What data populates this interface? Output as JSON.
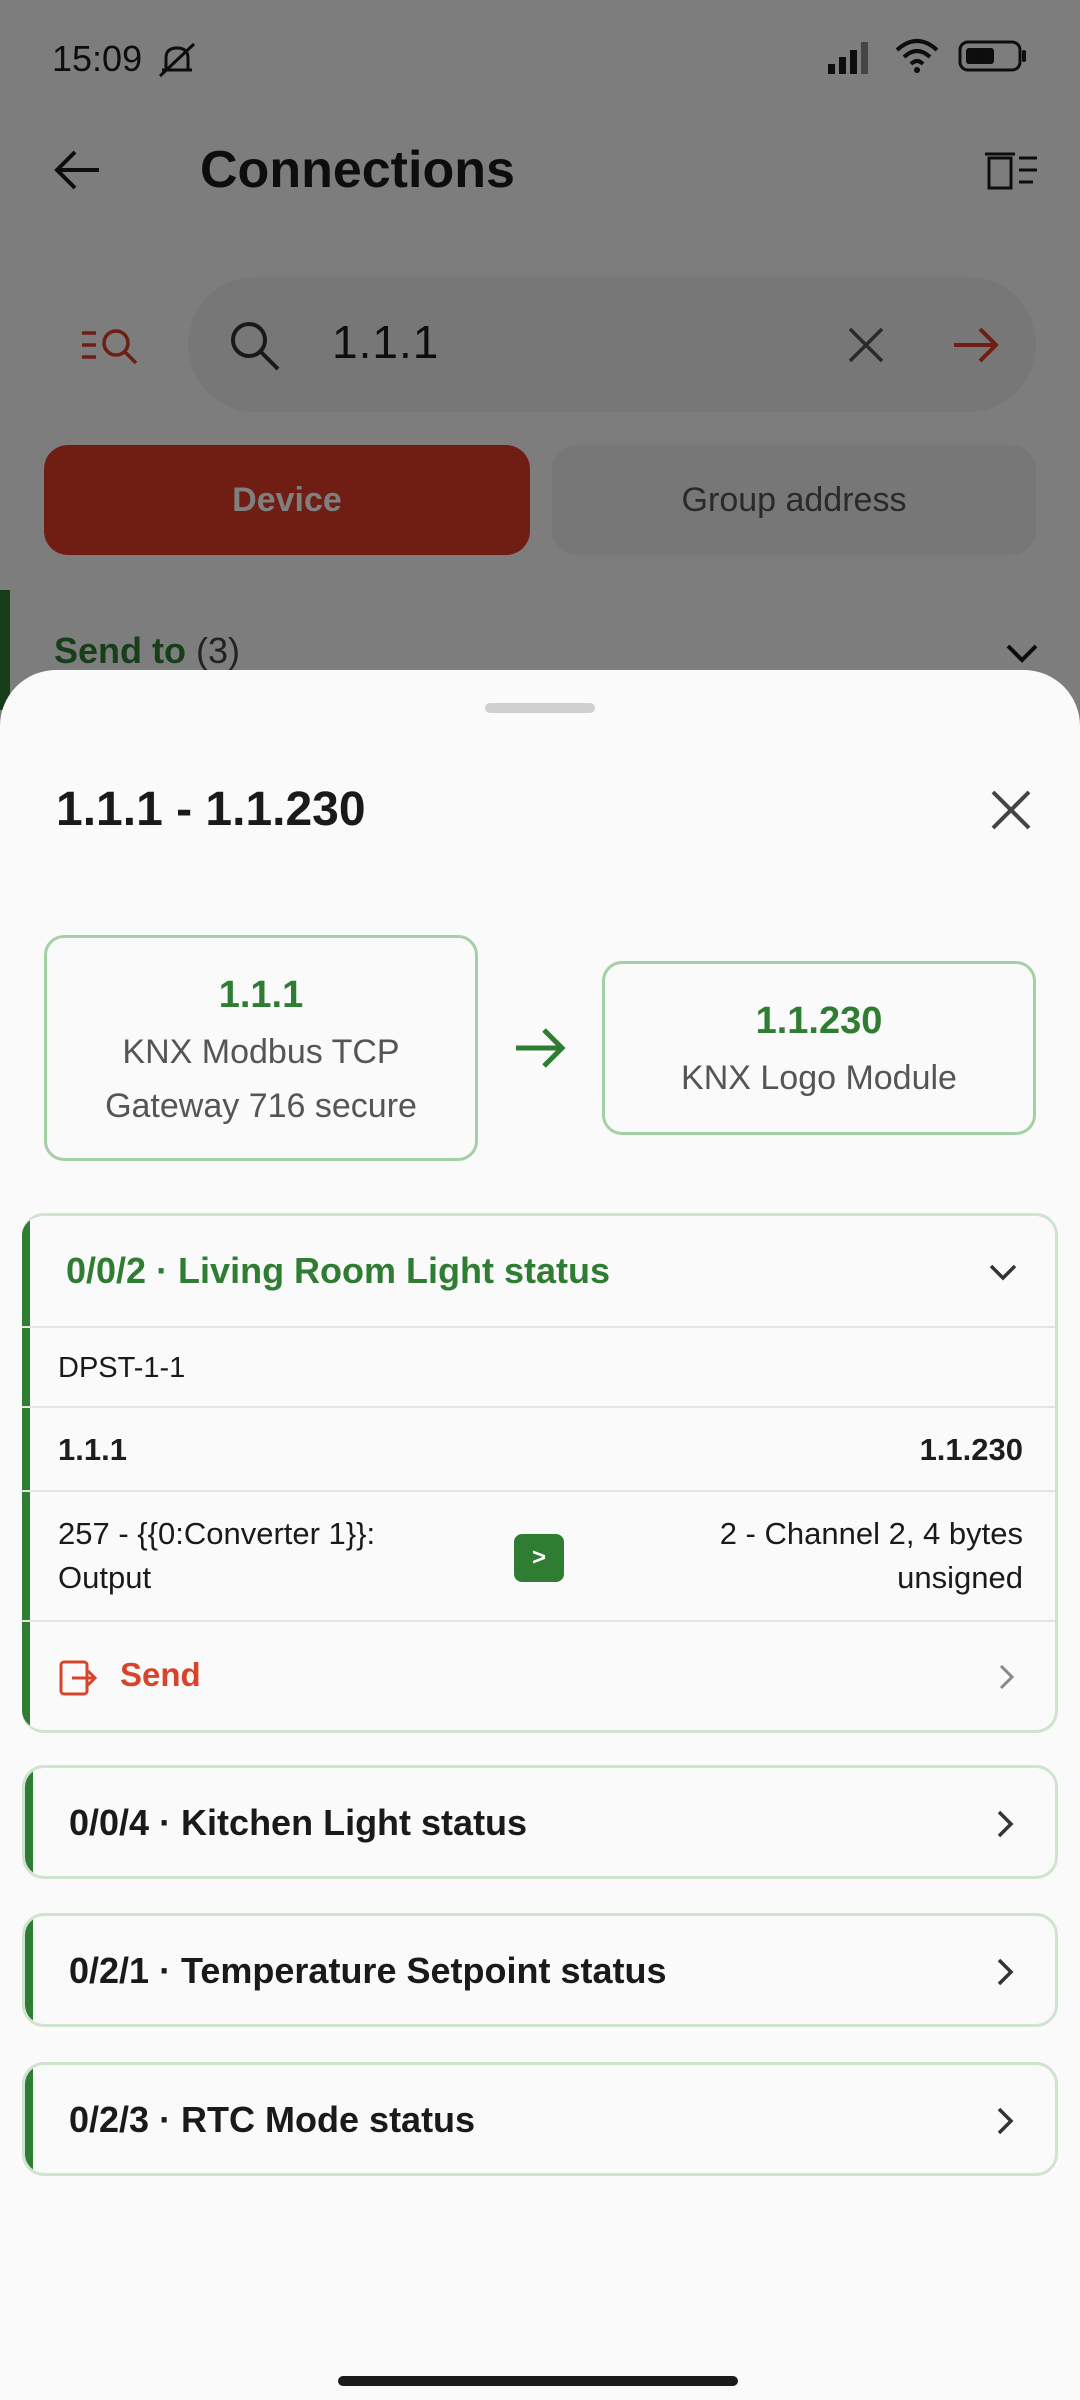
{
  "status": {
    "time": "15:09"
  },
  "appbar": {
    "title": "Connections"
  },
  "search": {
    "value": "1.1.1"
  },
  "segments": {
    "device": "Device",
    "group": "Group address"
  },
  "send_to": {
    "label": "Send to",
    "count": "(3)"
  },
  "sheet": {
    "title": "1.1.1 - 1.1.230",
    "source": {
      "address": "1.1.1",
      "name_line1": "KNX Modbus TCP",
      "name_line2": "Gateway 716 secure"
    },
    "target": {
      "address": "1.1.230",
      "name": "KNX Logo Module"
    },
    "expanded": {
      "title": "0/0/2 · Living Room Light status",
      "dpst": "DPST-1-1",
      "from_address": "1.1.1",
      "to_address": "1.1.230",
      "from_channel_line1": "257 - {{0:Converter 1}}:",
      "from_channel_line2": "Output",
      "badge": ">",
      "to_channel_line1": "2 - Channel 2, 4 bytes",
      "to_channel_line2": "unsigned",
      "send_label": "Send"
    },
    "collapsed": [
      {
        "title": "0/0/4 · Kitchen Light status"
      },
      {
        "title": "0/2/1 · Temperature Setpoint status"
      },
      {
        "title": "0/2/3 · RTC Mode status"
      }
    ]
  },
  "colors": {
    "accent_red": "#e03a26",
    "accent_green": "#2f7d32",
    "send_red": "#d6452b"
  }
}
